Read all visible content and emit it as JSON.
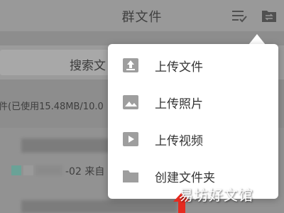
{
  "header": {
    "title": "群文件",
    "sort_icon": "sort-list-icon",
    "folder_icon": "folder-swap-icon"
  },
  "search": {
    "label": "搜索文"
  },
  "usage": {
    "text": "件(已使用15.48MB/10.0"
  },
  "file_list": {
    "row_meta": "-02  来自"
  },
  "menu": {
    "items": [
      {
        "label": "上传文件",
        "icon": "upload-icon"
      },
      {
        "label": "上传照片",
        "icon": "image-icon"
      },
      {
        "label": "上传视频",
        "icon": "video-icon"
      },
      {
        "label": "创建文件夹",
        "icon": "folder-icon"
      }
    ]
  },
  "watermark": {
    "text": "易坊好文馆"
  },
  "colors": {
    "overlay": "#8d8d8d",
    "menu_background": "#ffffff",
    "icon_gray": "#9e9e9e",
    "text": "#333333",
    "arrow_red": "#e62a1f",
    "thumb_teal": "#6aa297"
  }
}
